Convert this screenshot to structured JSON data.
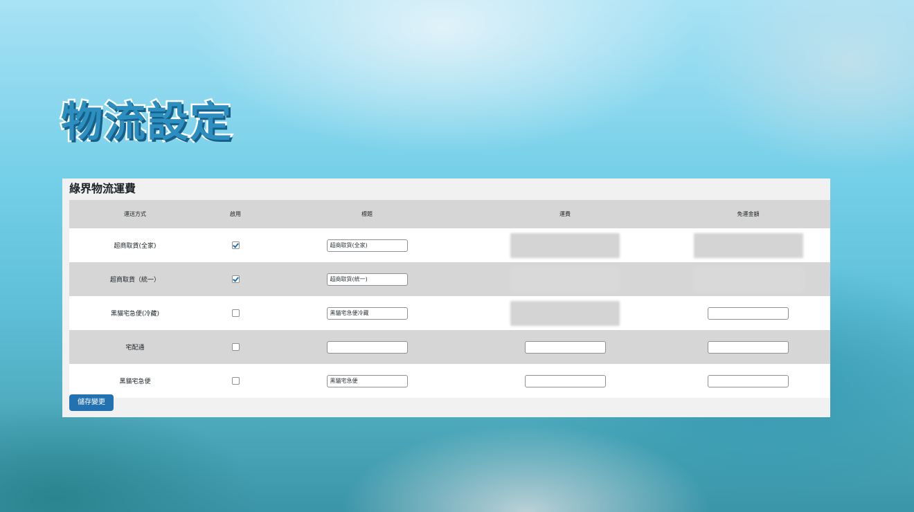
{
  "hero": {
    "title": "物流設定"
  },
  "panel": {
    "title": "綠界物流運費",
    "columns": [
      "運送方式",
      "啟用",
      "標題",
      "運費",
      "免運金額"
    ],
    "rows": [
      {
        "method": "超商取貨(全家)",
        "enabled": true,
        "title_value": "超商取貨(全家)",
        "fee": "blurred",
        "free_amount": "blurred"
      },
      {
        "method": "超商取貨（統一）",
        "enabled": true,
        "title_value": "超商取貨(統一)",
        "fee": "blurred",
        "free_amount": "blurred"
      },
      {
        "method": "黑貓宅急便(冷藏)",
        "enabled": false,
        "title_value": "黑貓宅急便冷藏",
        "fee": "blurred",
        "free_amount": ""
      },
      {
        "method": "宅配通",
        "enabled": false,
        "title_value": "",
        "fee": "",
        "free_amount": ""
      },
      {
        "method": "黑貓宅急便",
        "enabled": false,
        "title_value": "黑貓宅急便",
        "fee": "",
        "free_amount": ""
      }
    ],
    "save_label": "儲存變更"
  },
  "colors": {
    "accent": "#2271b1",
    "hero_fill": "#2c8fc0",
    "row_grey": "#d6d6d6"
  }
}
